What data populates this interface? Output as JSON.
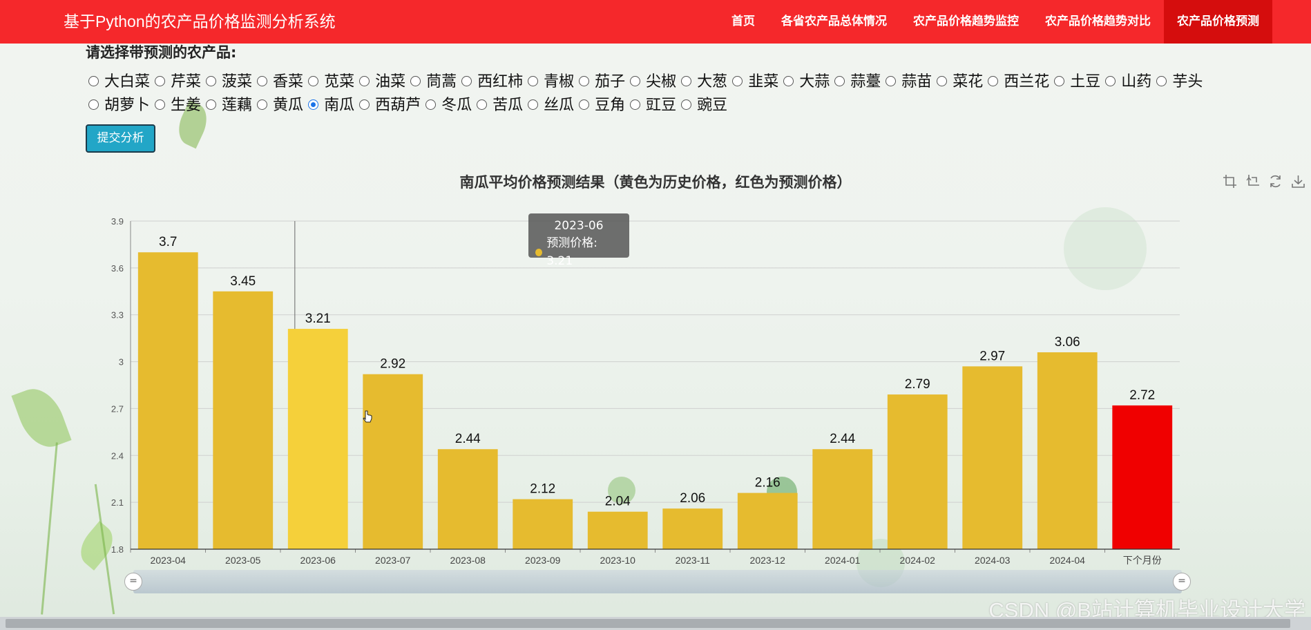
{
  "header": {
    "brand": "基于Python的农产品价格监测分析系统",
    "nav": [
      {
        "label": "首页",
        "active": false
      },
      {
        "label": "各省农产品总体情况",
        "active": false
      },
      {
        "label": "农产品价格趋势监控",
        "active": false
      },
      {
        "label": "农产品价格趋势对比",
        "active": false
      },
      {
        "label": "农产品价格预测",
        "active": true
      }
    ]
  },
  "form": {
    "prompt": "请选择带预测的农产品:",
    "options": [
      "大白菜",
      "芹菜",
      "菠菜",
      "香菜",
      "苋菜",
      "油菜",
      "茼蒿",
      "西红柿",
      "青椒",
      "茄子",
      "尖椒",
      "大葱",
      "韭菜",
      "大蒜",
      "蒜薹",
      "蒜苗",
      "菜花",
      "西兰花",
      "土豆",
      "山药",
      "芋头",
      "胡萝卜",
      "生姜",
      "莲藕",
      "黄瓜",
      "南瓜",
      "西葫芦",
      "冬瓜",
      "苦瓜",
      "丝瓜",
      "豆角",
      "豇豆",
      "豌豆"
    ],
    "selected": "南瓜",
    "submit_label": "提交分析"
  },
  "tooltip": {
    "title": "2023-06",
    "label": "预测价格: 3.21"
  },
  "toolbox": {
    "icons": [
      "zoom-select-icon",
      "zoom-reset-icon",
      "restore-icon",
      "download-icon"
    ]
  },
  "watermark": "CSDN @B站计算机毕业设计大学",
  "chart_data": {
    "type": "bar",
    "title": "南瓜平均价格预测结果（黄色为历史价格，红色为预测价格）",
    "categories": [
      "2023-04",
      "2023-05",
      "2023-06",
      "2023-07",
      "2023-08",
      "2023-09",
      "2023-10",
      "2023-11",
      "2023-12",
      "2024-01",
      "2024-02",
      "2024-03",
      "2024-04",
      "下个月份"
    ],
    "values": [
      3.7,
      3.45,
      3.21,
      2.92,
      2.44,
      2.12,
      2.04,
      2.06,
      2.16,
      2.44,
      2.79,
      2.97,
      3.06,
      2.72
    ],
    "colors": [
      "#e6bb2f",
      "#e6bb2f",
      "#f5d03a",
      "#e6bb2f",
      "#e6bb2f",
      "#e6bb2f",
      "#e6bb2f",
      "#e6bb2f",
      "#e6bb2f",
      "#e6bb2f",
      "#e6bb2f",
      "#e6bb2f",
      "#e6bb2f",
      "#f00000"
    ],
    "history_color": "#e6bb2f",
    "highlight_color": "#f5d03a",
    "forecast_color": "#f00000",
    "ylim": [
      1.8,
      3.9
    ],
    "yticks": [
      "1.8",
      "2.1",
      "2.4",
      "2.7",
      "3",
      "3.3",
      "3.6",
      "3.9"
    ],
    "highlighted_category": "2023-06",
    "grid": true
  }
}
